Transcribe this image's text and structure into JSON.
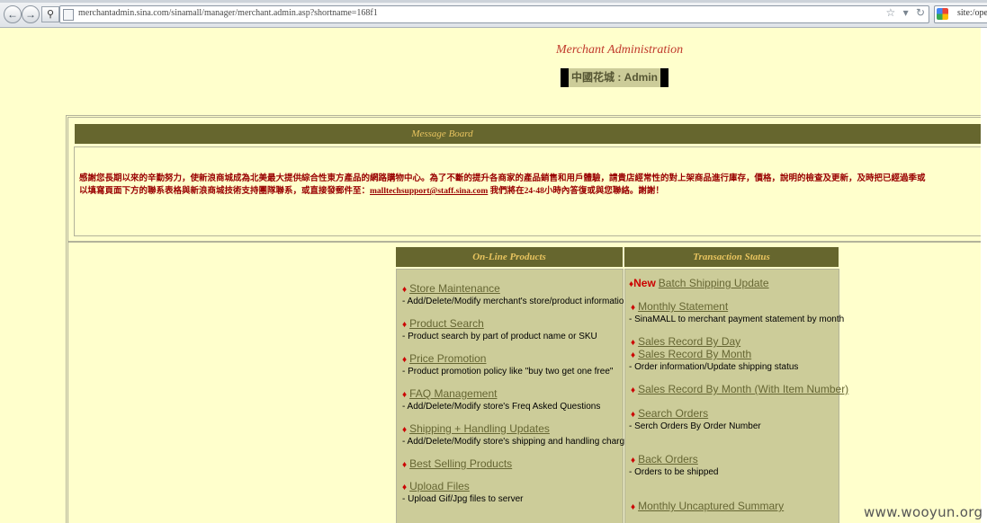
{
  "browser": {
    "url": "merchantadmin.sina.com/sinamall/manager/merchant.admin.asp?shortname=168f1",
    "search_text": "site:/ope",
    "back_icon": "back-arrow-icon",
    "forward_icon": "forward-arrow-icon"
  },
  "header": {
    "title": "Merchant Administration",
    "store_label": "中國花城 : Admin"
  },
  "message_board": {
    "title": "Message Board",
    "text_before_email": "感謝您長期以來的辛勤努力，使新浪商城成為北美最大提供綜合性東方產品的網路購物中心。為了不斷的提升各商家的產品銷售和用戶體驗，請貴店經常性的對上架商品進行庫存，價格，說明的檢查及更新，及時把已經過季或",
    "text_line2_before_email": "以填寫頁面下方的聯系表格與新浪商城技術支持團隊聯系，或直接發郵件至：",
    "email": "malltechsupport@staff.sina.com",
    "text_after_email": " 我們將在24-48小時內答復或與您聯絡。謝謝！"
  },
  "online_products": {
    "title": "On-Line Products",
    "items": [
      {
        "label": "Store Maintenance",
        "desc": "- Add/Delete/Modify merchant's store/product information"
      },
      {
        "label": "Product Search",
        "desc": "- Product search by part of product name or SKU"
      },
      {
        "label": "Price Promotion",
        "desc": "- Product promotion policy like \"buy two get one free\""
      },
      {
        "label": "FAQ Management",
        "desc": "- Add/Delete/Modify store's Freq Asked Questions"
      },
      {
        "label": "Shipping + Handling Updates",
        "desc": "- Add/Delete/Modify store's shipping and handling charges"
      },
      {
        "label": "Best Selling Products",
        "desc": ""
      },
      {
        "label": "Upload Files",
        "desc": "- Upload Gif/Jpg files to server"
      }
    ]
  },
  "transaction_status": {
    "title": "Transaction Status",
    "new_badge": "New",
    "items": [
      {
        "label": "Batch Shipping Update",
        "desc": ""
      },
      {
        "label": "Monthly Statement",
        "desc": "- SinaMALL to merchant payment statement by month"
      },
      {
        "label": "Sales Record By Day",
        "desc": ""
      },
      {
        "label": "Sales Record By Month",
        "desc": "- Order information/Update shipping status"
      },
      {
        "label": "Sales Record By Month (With Item Number)",
        "desc": ""
      },
      {
        "label": "Search Orders",
        "desc": "- Serch Orders By Order Number"
      },
      {
        "label": "Back Orders",
        "desc": "- Orders to be shipped"
      },
      {
        "label": "Monthly Uncaptured Summary",
        "desc": ""
      }
    ]
  },
  "watermark": "www.wooyun.org",
  "colors": {
    "page_bg": "#ffffcc",
    "header_bar": "#66662e",
    "header_text": "#e8c45f",
    "panel_bg": "#cccc99",
    "link": "#666633",
    "accent_red": "#cc0000"
  }
}
